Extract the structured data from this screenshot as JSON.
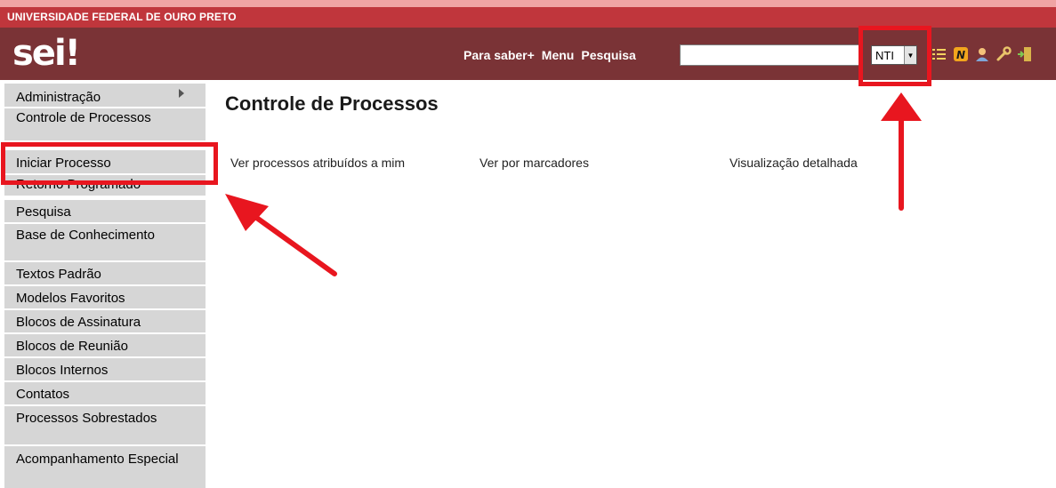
{
  "header": {
    "org_name": "UNIVERSIDADE FEDERAL DE OURO PRETO",
    "logo_text": "sei",
    "logo_mark": "!",
    "links": [
      "Para saber+",
      "Menu",
      "Pesquisa"
    ],
    "search_value": "",
    "unit_selected": "NTI",
    "icons": [
      "list-icon",
      "notes-n-icon",
      "user-icon",
      "wrench-icon",
      "exit-door-icon"
    ]
  },
  "sidebar": {
    "items": [
      {
        "label": "Administração"
      },
      {
        "label": "Controle de Processos"
      },
      {
        "label": "Iniciar Processo"
      },
      {
        "label": "Retorno Programado"
      },
      {
        "label": "Pesquisa"
      },
      {
        "label": "Base de Conhecimento"
      },
      {
        "label": "Textos Padrão"
      },
      {
        "label": "Modelos Favoritos"
      },
      {
        "label": "Blocos de Assinatura"
      },
      {
        "label": "Blocos de Reunião"
      },
      {
        "label": "Blocos Internos"
      },
      {
        "label": "Contatos"
      },
      {
        "label": "Processos Sobrestados"
      },
      {
        "label": "Acompanhamento Especial"
      }
    ]
  },
  "main": {
    "title": "Controle de Processos",
    "links": [
      "Ver processos atribuídos a mim",
      "Ver por marcadores",
      "Visualização detalhada"
    ]
  },
  "colors": {
    "org_band": "#c0363c",
    "header": "#7a3336",
    "sidebar_item": "#d6d6d6",
    "annotation": "#e8161f"
  }
}
